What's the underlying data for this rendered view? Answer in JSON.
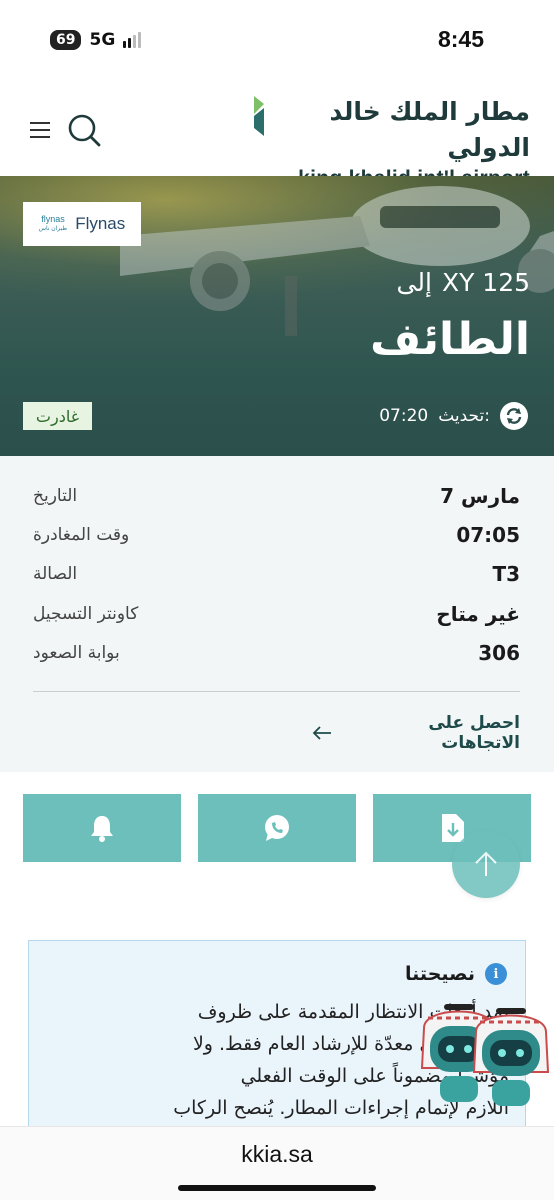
{
  "status_bar": {
    "battery": "69",
    "network": "5G",
    "time": "8:45"
  },
  "header": {
    "logo_ar": "مطار الملك خالد الدولي",
    "logo_en": "king khalid int'l airport",
    "menu_icon": "hamburger-icon",
    "search_icon": "search-icon"
  },
  "flight": {
    "airline_name": "Flynas",
    "airline_small_1": "flynas",
    "airline_small_2": "طيران ناس",
    "flight_number": "XY 125",
    "to_label": "إلى",
    "destination": "الطائف",
    "update_label": "تحديث:",
    "update_time": "07:20",
    "status": "غادرت"
  },
  "details": [
    {
      "label": "التاريخ",
      "value": "مارس 7"
    },
    {
      "label": "وقت المغادرة",
      "value": "07:05"
    },
    {
      "label": "الصالة",
      "value": "T3"
    },
    {
      "label": "كاونتر التسجيل",
      "value": "غير متاح"
    },
    {
      "label": "بوابة الصعود",
      "value": "306"
    }
  ],
  "directions": {
    "label": "احصل على الاتجاهات"
  },
  "actions": {
    "buttons": [
      "bell-icon",
      "whatsapp-icon",
      "download-file-icon"
    ],
    "scroll_top": "arrow-up-icon"
  },
  "tip": {
    "title": "نصيحتنا",
    "lines": [
      "تمد أوقات الانتظار المقدمة على ظروف",
      "ميكية، وهي معدّة للإرشاد العام فقط. ولا",
      "مؤشراً مضموناً على الوقت الفعلي",
      "اللازم لإتمام إجراءات المطار. يُنصح الركاب"
    ]
  },
  "browser": {
    "url": "kkia.sa"
  },
  "colors": {
    "accent": "#6dbfbb",
    "dark_teal": "#1e3a3a",
    "hero": "#2f5550",
    "badge_bg": "#e8f4e2",
    "info_blue": "#3b8fd6"
  }
}
